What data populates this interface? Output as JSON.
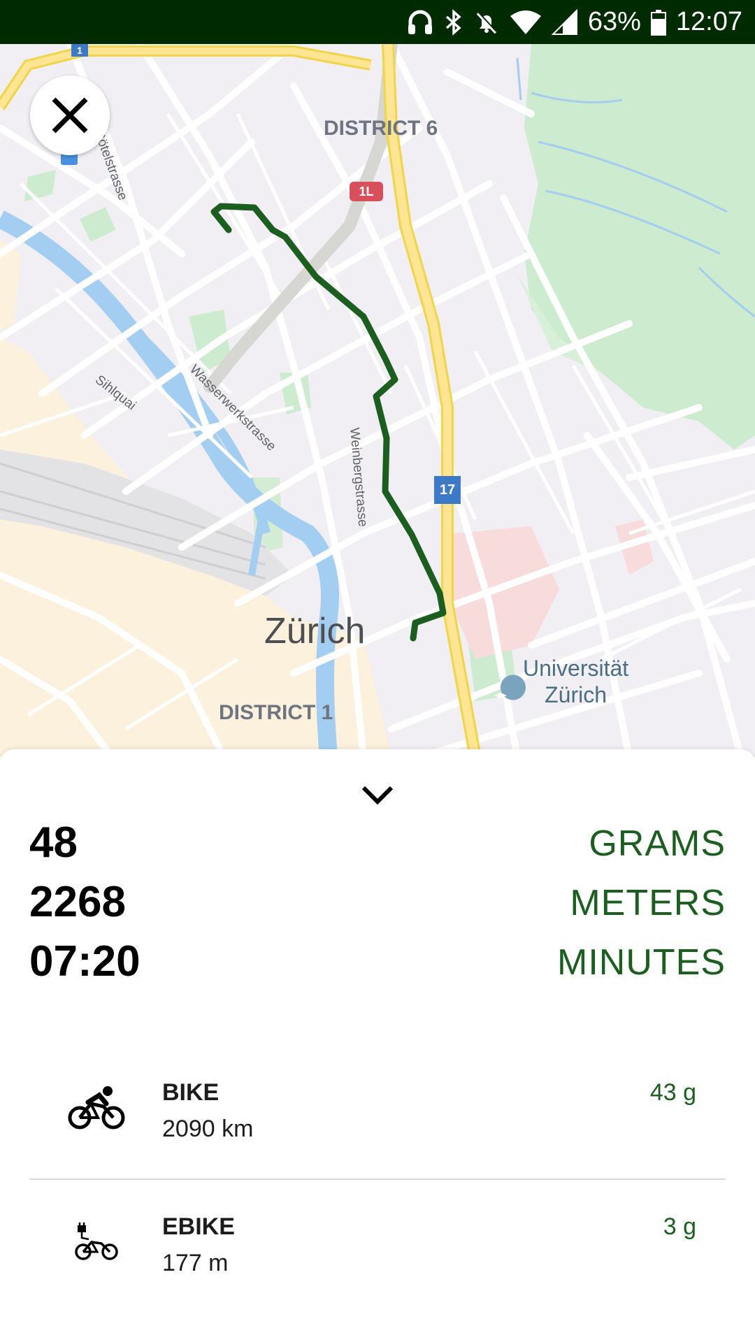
{
  "status_bar": {
    "battery": "63%",
    "time": "12:07",
    "icons": [
      "headphones-icon",
      "bluetooth-icon",
      "notifications-off-icon",
      "wifi-icon",
      "cell-signal-icon",
      "battery-icon"
    ]
  },
  "map": {
    "district_6": "DISTRICT 6",
    "district_1": "DISTRICT 1",
    "city": "Zürich",
    "poi_line1": "Universität",
    "poi_line2": "Zürich",
    "street_rotel": "Rötelstrasse",
    "street_sihlquai": "Sihlquai",
    "street_wasserwerk": "Wasserwerkstrasse",
    "street_weinberg": "Weinbergstrasse",
    "shield_1l": "1L",
    "shield_17": "17",
    "shield_top": "1",
    "route_color": "#1b5e20"
  },
  "close_button": {
    "icon": "close-icon"
  },
  "sheet": {
    "collapse_icon": "chevron-down-icon",
    "stats": [
      {
        "value": "48",
        "unit": "GRAMS"
      },
      {
        "value": "2268",
        "unit": "METERS"
      },
      {
        "value": "07:20",
        "unit": "MINUTES"
      }
    ],
    "modes": [
      {
        "icon": "bike-icon",
        "name": "BIKE",
        "distance": "2090 km",
        "co2": "43 g"
      },
      {
        "icon": "ebike-icon",
        "name": "EBIKE",
        "distance": "177 m",
        "co2": "3 g"
      }
    ]
  },
  "colors": {
    "accent": "#1b5e20",
    "status_bar": "#002a00"
  }
}
